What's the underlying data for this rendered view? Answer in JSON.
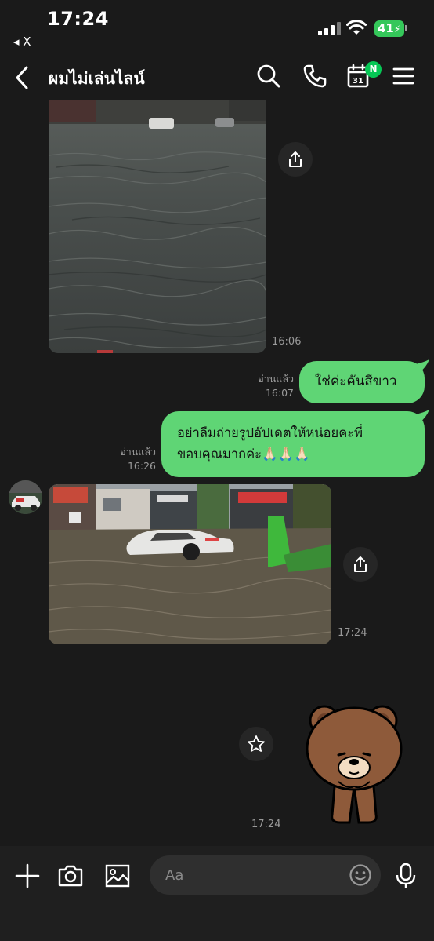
{
  "status_bar": {
    "time": "17:24",
    "back_app": "◂ X",
    "battery": "41"
  },
  "header": {
    "title": "ผมไม่เล่นไลน์",
    "calendar_day": "31",
    "calendar_badge": "N"
  },
  "messages": [
    {
      "type": "photo",
      "sender": "other",
      "time": "16:06"
    },
    {
      "type": "text",
      "sender": "me",
      "read_label": "อ่านแล้ว",
      "time": "16:07",
      "lines": [
        "ใช่ค่ะคันสีขาว"
      ]
    },
    {
      "type": "text",
      "sender": "me",
      "read_label": "อ่านแล้ว",
      "time": "16:26",
      "lines": [
        "อย่าลืมถ่ายรูปอัปเดตให้หน่อยคะพี่",
        "ขอบคุณมากค่ะ🙏🏻🙏🏻🙏🏻"
      ]
    },
    {
      "type": "photo",
      "sender": "other",
      "time": "17:24"
    },
    {
      "type": "sticker",
      "sender": "other",
      "time": "17:24"
    }
  ],
  "composer": {
    "placeholder": "Aa"
  },
  "colors": {
    "background": "#1a1a1a",
    "bubble_me": "#5fd575",
    "badge": "#06c755",
    "battery": "#35c75a"
  },
  "icons": [
    "back-icon",
    "search-icon",
    "phone-icon",
    "calendar-icon",
    "menu-icon",
    "share-icon",
    "star-icon",
    "plus-icon",
    "camera-icon",
    "image-icon",
    "emoji-icon",
    "microphone-icon"
  ]
}
